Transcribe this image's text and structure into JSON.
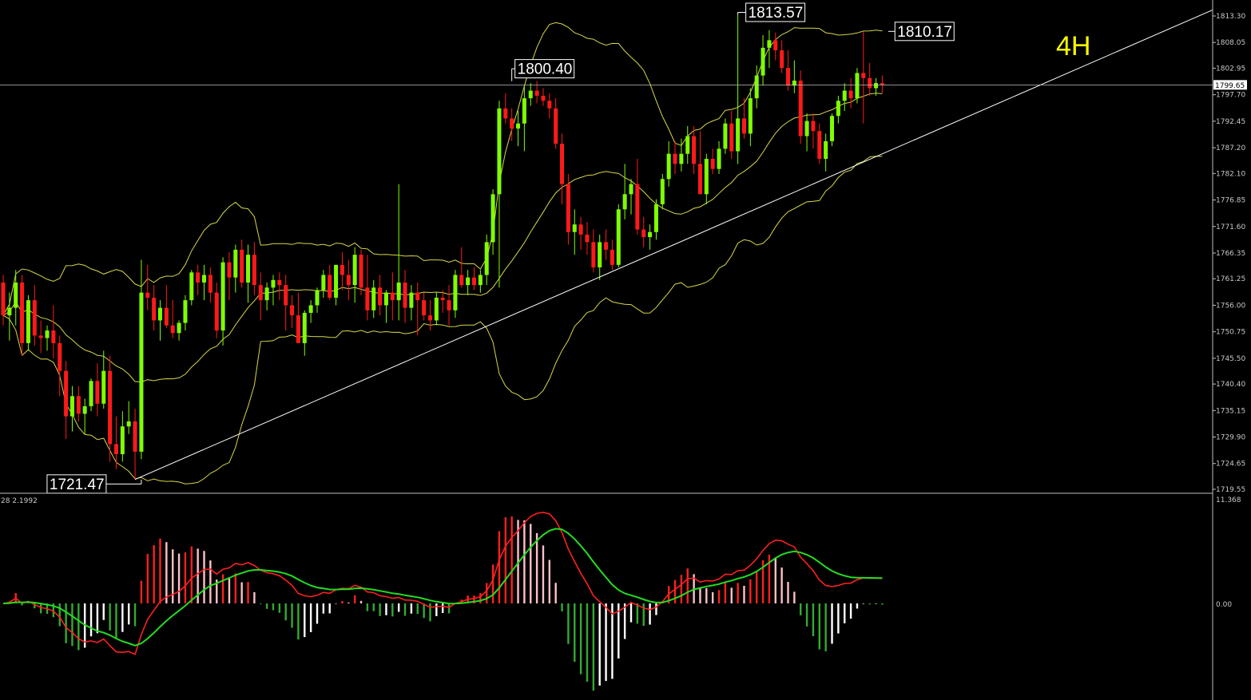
{
  "chart_data": {
    "type": "candlestick",
    "timeframe": "4H",
    "colors": {
      "bull": "#7fff00",
      "bear": "#ff1a1a",
      "bollinger": "#d7d74a",
      "trendline": "#ffffff",
      "macd_line": "#ff2020",
      "signal_line": "#22dd22",
      "hist_pos_up": "#ff2020",
      "hist_pos_down": "#ffc0c8",
      "hist_neg_down": "#33aa33",
      "hist_neg_up": "#ffffff",
      "background": "#000000",
      "axis_text": "#c8c8c8"
    },
    "price_axis": {
      "ticks": [
        "1813.30",
        "1808.05",
        "1802.95",
        "1797.70",
        "1792.45",
        "1787.20",
        "1782.10",
        "1776.85",
        "1771.60",
        "1766.35",
        "1761.25",
        "1756.00",
        "1750.75",
        "1745.50",
        "1740.40",
        "1735.15",
        "1729.90",
        "1724.65",
        "1719.55"
      ],
      "current_price": "1799.65",
      "range": [
        1718,
        1815
      ]
    },
    "annotations": [
      {
        "text": "1721.47",
        "price": 1721.47,
        "candle": 22
      },
      {
        "text": "1800.40",
        "price": 1800.4,
        "candle": 81
      },
      {
        "text": "1813.57",
        "price": 1813.57,
        "candle": 117
      },
      {
        "text": "1810.17",
        "price": 1810.17,
        "candle": 141
      }
    ],
    "trendline": {
      "start": {
        "candle": 21,
        "price": 1721.5
      },
      "end_price_at_right": 1814.5
    },
    "candles": [
      [
        1760.5,
        1762.0,
        1752.0,
        1754.0
      ],
      [
        1754.0,
        1758.5,
        1749.0,
        1755.5
      ],
      [
        1755.5,
        1763.0,
        1752.0,
        1760.5
      ],
      [
        1760.5,
        1762.0,
        1746.0,
        1748.5
      ],
      [
        1748.5,
        1758.0,
        1747.0,
        1757.0
      ],
      [
        1757.0,
        1760.0,
        1748.0,
        1750.0
      ],
      [
        1750.0,
        1753.0,
        1746.5,
        1749.5
      ],
      [
        1749.5,
        1752.0,
        1747.0,
        1751.0
      ],
      [
        1751.0,
        1756.0,
        1745.5,
        1748.5
      ],
      [
        1748.5,
        1750.0,
        1738.0,
        1743.0
      ],
      [
        1743.0,
        1745.0,
        1729.5,
        1734.0
      ],
      [
        1734.0,
        1740.0,
        1731.0,
        1738.0
      ],
      [
        1738.0,
        1740.0,
        1733.0,
        1734.5
      ],
      [
        1734.5,
        1737.5,
        1730.5,
        1736.0
      ],
      [
        1736.0,
        1741.5,
        1735.0,
        1741.0
      ],
      [
        1741.0,
        1744.5,
        1734.0,
        1736.5
      ],
      [
        1736.5,
        1747.0,
        1735.5,
        1743.0
      ],
      [
        1743.0,
        1746.0,
        1725.0,
        1728.5
      ],
      [
        1728.5,
        1734.0,
        1723.5,
        1726.5
      ],
      [
        1726.5,
        1735.0,
        1725.0,
        1732.0
      ],
      [
        1732.0,
        1737.0,
        1730.5,
        1733.0
      ],
      [
        1733.0,
        1735.5,
        1721.47,
        1727.0
      ],
      [
        1727.0,
        1765.0,
        1725.5,
        1758.5
      ],
      [
        1758.5,
        1764.0,
        1755.0,
        1757.5
      ],
      [
        1757.5,
        1760.0,
        1751.0,
        1753.0
      ],
      [
        1753.0,
        1757.0,
        1749.0,
        1755.5
      ],
      [
        1755.5,
        1760.0,
        1751.5,
        1752.0
      ],
      [
        1752.0,
        1757.0,
        1749.5,
        1750.5
      ],
      [
        1750.5,
        1753.0,
        1749.0,
        1752.5
      ],
      [
        1752.5,
        1758.0,
        1751.0,
        1757.0
      ],
      [
        1757.0,
        1763.0,
        1756.0,
        1762.5
      ],
      [
        1762.5,
        1764.0,
        1758.0,
        1760.5
      ],
      [
        1760.5,
        1764.0,
        1757.0,
        1762.0
      ],
      [
        1762.0,
        1763.5,
        1756.5,
        1758.5
      ],
      [
        1758.5,
        1760.5,
        1749.5,
        1751.0
      ],
      [
        1751.0,
        1765.5,
        1748.0,
        1764.5
      ],
      [
        1764.5,
        1766.5,
        1757.0,
        1761.5
      ],
      [
        1761.5,
        1768.0,
        1758.5,
        1767.0
      ],
      [
        1767.0,
        1769.0,
        1759.5,
        1760.5
      ],
      [
        1760.5,
        1768.0,
        1756.5,
        1766.0
      ],
      [
        1766.0,
        1768.5,
        1758.0,
        1760.0
      ],
      [
        1760.0,
        1762.5,
        1753.0,
        1757.0
      ],
      [
        1757.0,
        1760.5,
        1755.0,
        1759.5
      ],
      [
        1759.5,
        1762.0,
        1756.0,
        1761.0
      ],
      [
        1761.0,
        1762.5,
        1757.0,
        1760.0
      ],
      [
        1760.0,
        1762.0,
        1751.0,
        1756.0
      ],
      [
        1756.0,
        1758.0,
        1751.5,
        1754.0
      ],
      [
        1754.0,
        1758.5,
        1749.0,
        1748.5
      ],
      [
        1748.5,
        1755.0,
        1746.0,
        1754.5
      ],
      [
        1754.5,
        1757.0,
        1752.5,
        1756.0
      ],
      [
        1756.0,
        1759.5,
        1754.5,
        1759.0
      ],
      [
        1759.0,
        1763.0,
        1757.5,
        1762.0
      ],
      [
        1762.0,
        1764.0,
        1757.0,
        1757.5
      ],
      [
        1757.5,
        1764.0,
        1756.0,
        1764.0
      ],
      [
        1764.0,
        1766.5,
        1759.0,
        1762.0
      ],
      [
        1762.0,
        1765.0,
        1757.0,
        1760.0
      ],
      [
        1760.0,
        1767.5,
        1756.5,
        1766.0
      ],
      [
        1766.0,
        1767.0,
        1758.0,
        1759.5
      ],
      [
        1759.5,
        1766.0,
        1753.0,
        1755.0
      ],
      [
        1755.0,
        1761.0,
        1753.5,
        1759.5
      ],
      [
        1759.5,
        1762.0,
        1754.0,
        1756.0
      ],
      [
        1756.0,
        1759.0,
        1752.5,
        1758.5
      ],
      [
        1758.5,
        1762.5,
        1753.0,
        1757.0
      ],
      [
        1757.0,
        1780.0,
        1753.0,
        1760.5
      ],
      [
        1760.5,
        1763.0,
        1752.5,
        1755.5
      ],
      [
        1755.5,
        1760.0,
        1753.0,
        1758.5
      ],
      [
        1758.5,
        1760.5,
        1750.0,
        1757.0
      ],
      [
        1757.0,
        1758.5,
        1753.0,
        1754.0
      ],
      [
        1754.0,
        1757.0,
        1751.0,
        1753.0
      ],
      [
        1753.0,
        1758.5,
        1752.0,
        1757.5
      ],
      [
        1757.5,
        1759.0,
        1754.5,
        1757.0
      ],
      [
        1757.0,
        1760.0,
        1752.0,
        1755.0
      ],
      [
        1755.0,
        1763.0,
        1753.5,
        1762.0
      ],
      [
        1762.0,
        1767.5,
        1759.5,
        1760.0
      ],
      [
        1760.0,
        1763.0,
        1758.0,
        1761.5
      ],
      [
        1761.5,
        1763.5,
        1759.0,
        1760.0
      ],
      [
        1760.0,
        1763.0,
        1758.5,
        1762.0
      ],
      [
        1762.0,
        1770.0,
        1760.0,
        1768.5
      ],
      [
        1768.5,
        1779.0,
        1766.0,
        1778.0
      ],
      [
        1778.0,
        1796.5,
        1759.5,
        1795.0
      ],
      [
        1795.0,
        1798.0,
        1792.0,
        1793.0
      ],
      [
        1793.0,
        1795.0,
        1788.5,
        1791.0
      ],
      [
        1791.0,
        1794.5,
        1787.5,
        1792.0
      ],
      [
        1792.0,
        1799.5,
        1786.5,
        1797.0
      ],
      [
        1797.0,
        1800.0,
        1795.5,
        1798.5
      ],
      [
        1798.5,
        1800.4,
        1796.0,
        1797.5
      ],
      [
        1797.5,
        1799.0,
        1795.5,
        1796.5
      ],
      [
        1796.5,
        1798.0,
        1793.0,
        1795.0
      ],
      [
        1795.0,
        1797.0,
        1787.0,
        1788.0
      ],
      [
        1788.0,
        1790.0,
        1776.0,
        1780.0
      ],
      [
        1780.0,
        1782.0,
        1768.0,
        1770.5
      ],
      [
        1770.5,
        1775.0,
        1766.0,
        1772.0
      ],
      [
        1772.0,
        1773.5,
        1767.0,
        1770.0
      ],
      [
        1770.0,
        1772.5,
        1766.0,
        1768.5
      ],
      [
        1768.5,
        1771.0,
        1762.5,
        1763.5
      ],
      [
        1763.5,
        1770.0,
        1761.0,
        1768.5
      ],
      [
        1768.5,
        1771.0,
        1765.0,
        1767.0
      ],
      [
        1767.0,
        1769.0,
        1763.0,
        1764.0
      ],
      [
        1764.0,
        1776.0,
        1763.5,
        1775.0
      ],
      [
        1775.0,
        1784.0,
        1773.0,
        1778.0
      ],
      [
        1778.0,
        1781.0,
        1774.0,
        1780.0
      ],
      [
        1780.0,
        1785.0,
        1770.0,
        1771.0
      ],
      [
        1771.0,
        1773.5,
        1767.5,
        1769.5
      ],
      [
        1769.5,
        1772.0,
        1767.0,
        1770.5
      ],
      [
        1770.5,
        1777.0,
        1769.0,
        1776.0
      ],
      [
        1776.0,
        1782.0,
        1775.0,
        1781.0
      ],
      [
        1781.0,
        1788.5,
        1779.5,
        1786.0
      ],
      [
        1786.0,
        1788.5,
        1782.0,
        1784.0
      ],
      [
        1784.0,
        1789.0,
        1782.5,
        1786.0
      ],
      [
        1786.0,
        1791.5,
        1784.0,
        1789.5
      ],
      [
        1789.5,
        1791.5,
        1782.0,
        1784.0
      ],
      [
        1784.0,
        1790.5,
        1778.0,
        1778.0
      ],
      [
        1778.0,
        1786.0,
        1776.0,
        1785.0
      ],
      [
        1785.0,
        1787.0,
        1782.0,
        1783.0
      ],
      [
        1783.0,
        1788.5,
        1782.0,
        1787.0
      ],
      [
        1787.0,
        1793.0,
        1786.0,
        1792.0
      ],
      [
        1792.0,
        1794.5,
        1785.0,
        1786.5
      ],
      [
        1786.5,
        1813.57,
        1784.0,
        1793.0
      ],
      [
        1793.0,
        1797.0,
        1789.0,
        1790.0
      ],
      [
        1790.0,
        1799.0,
        1787.5,
        1797.0
      ],
      [
        1797.0,
        1803.5,
        1795.0,
        1801.5
      ],
      [
        1801.5,
        1809.5,
        1799.5,
        1807.0
      ],
      [
        1807.0,
        1810.5,
        1803.0,
        1808.5
      ],
      [
        1808.5,
        1810.0,
        1804.5,
        1806.5
      ],
      [
        1806.5,
        1808.5,
        1802.0,
        1803.0
      ],
      [
        1803.0,
        1806.5,
        1798.5,
        1799.5
      ],
      [
        1799.5,
        1804.5,
        1798.0,
        1800.5
      ],
      [
        1800.5,
        1802.5,
        1788.0,
        1789.5
      ],
      [
        1789.5,
        1794.0,
        1786.5,
        1792.5
      ],
      [
        1792.5,
        1794.0,
        1787.0,
        1790.5
      ],
      [
        1790.5,
        1792.0,
        1784.0,
        1785.0
      ],
      [
        1785.0,
        1790.0,
        1782.5,
        1788.5
      ],
      [
        1788.5,
        1794.0,
        1787.5,
        1793.5
      ],
      [
        1793.5,
        1797.5,
        1792.0,
        1796.5
      ],
      [
        1796.5,
        1800.0,
        1794.5,
        1798.5
      ],
      [
        1798.5,
        1801.0,
        1795.0,
        1797.0
      ],
      [
        1797.0,
        1803.0,
        1796.0,
        1802.0
      ],
      [
        1802.0,
        1810.17,
        1792.0,
        1801.0
      ],
      [
        1801.0,
        1804.0,
        1797.5,
        1799.0
      ],
      [
        1799.0,
        1801.0,
        1797.5,
        1800.0
      ],
      [
        1800.0,
        1801.5,
        1798.0,
        1799.65
      ]
    ],
    "macd": {
      "info_label": "28 2.1992",
      "scale_top": "11.368",
      "scale_zero": "0.00"
    }
  }
}
